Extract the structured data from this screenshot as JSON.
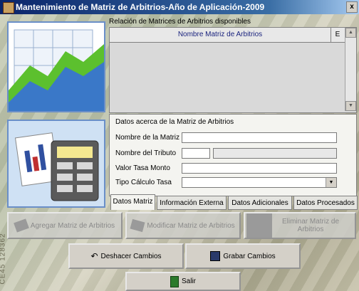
{
  "window": {
    "title": "Mantenimiento de Matriz de Arbitrios-Año de Aplicación-2009",
    "close": "x"
  },
  "list": {
    "section_label": "Relación de Matrices de Arbitrios disponibles",
    "col_nombre": "Nombre Matriz de Arbitrios",
    "col_e": "E",
    "scroll_up": "▲",
    "scroll_down": "▼"
  },
  "form": {
    "section_label": "Datos acerca de la Matriz de Arbitrios",
    "nombre_label": "Nombre de la Matriz",
    "nombre_value": "",
    "tributo_label": "Nombre del Tributo",
    "tributo_code": "",
    "tributo_name": "",
    "tasa_label": "Valor Tasa Monto",
    "tasa_value": "",
    "tipo_label": "Tipo Cálculo Tasa",
    "tipo_value": "",
    "dropdown_arrow": "▼"
  },
  "tabs": [
    "Datos Matriz",
    "Información Externa",
    "Datos Adicionales",
    "Datos Procesados"
  ],
  "buttons": {
    "agregar": "Agregar Matriz de Arbitrios",
    "modificar": "Modificar Matriz de Arbitrios",
    "eliminar": "Eliminar Matriz de Arbitrios",
    "deshacer": "Deshacer Cambios",
    "grabar": "Grabar Cambios",
    "salir": "Salir",
    "deshacer_icon": "↶"
  },
  "background_text": "CE45 128362"
}
